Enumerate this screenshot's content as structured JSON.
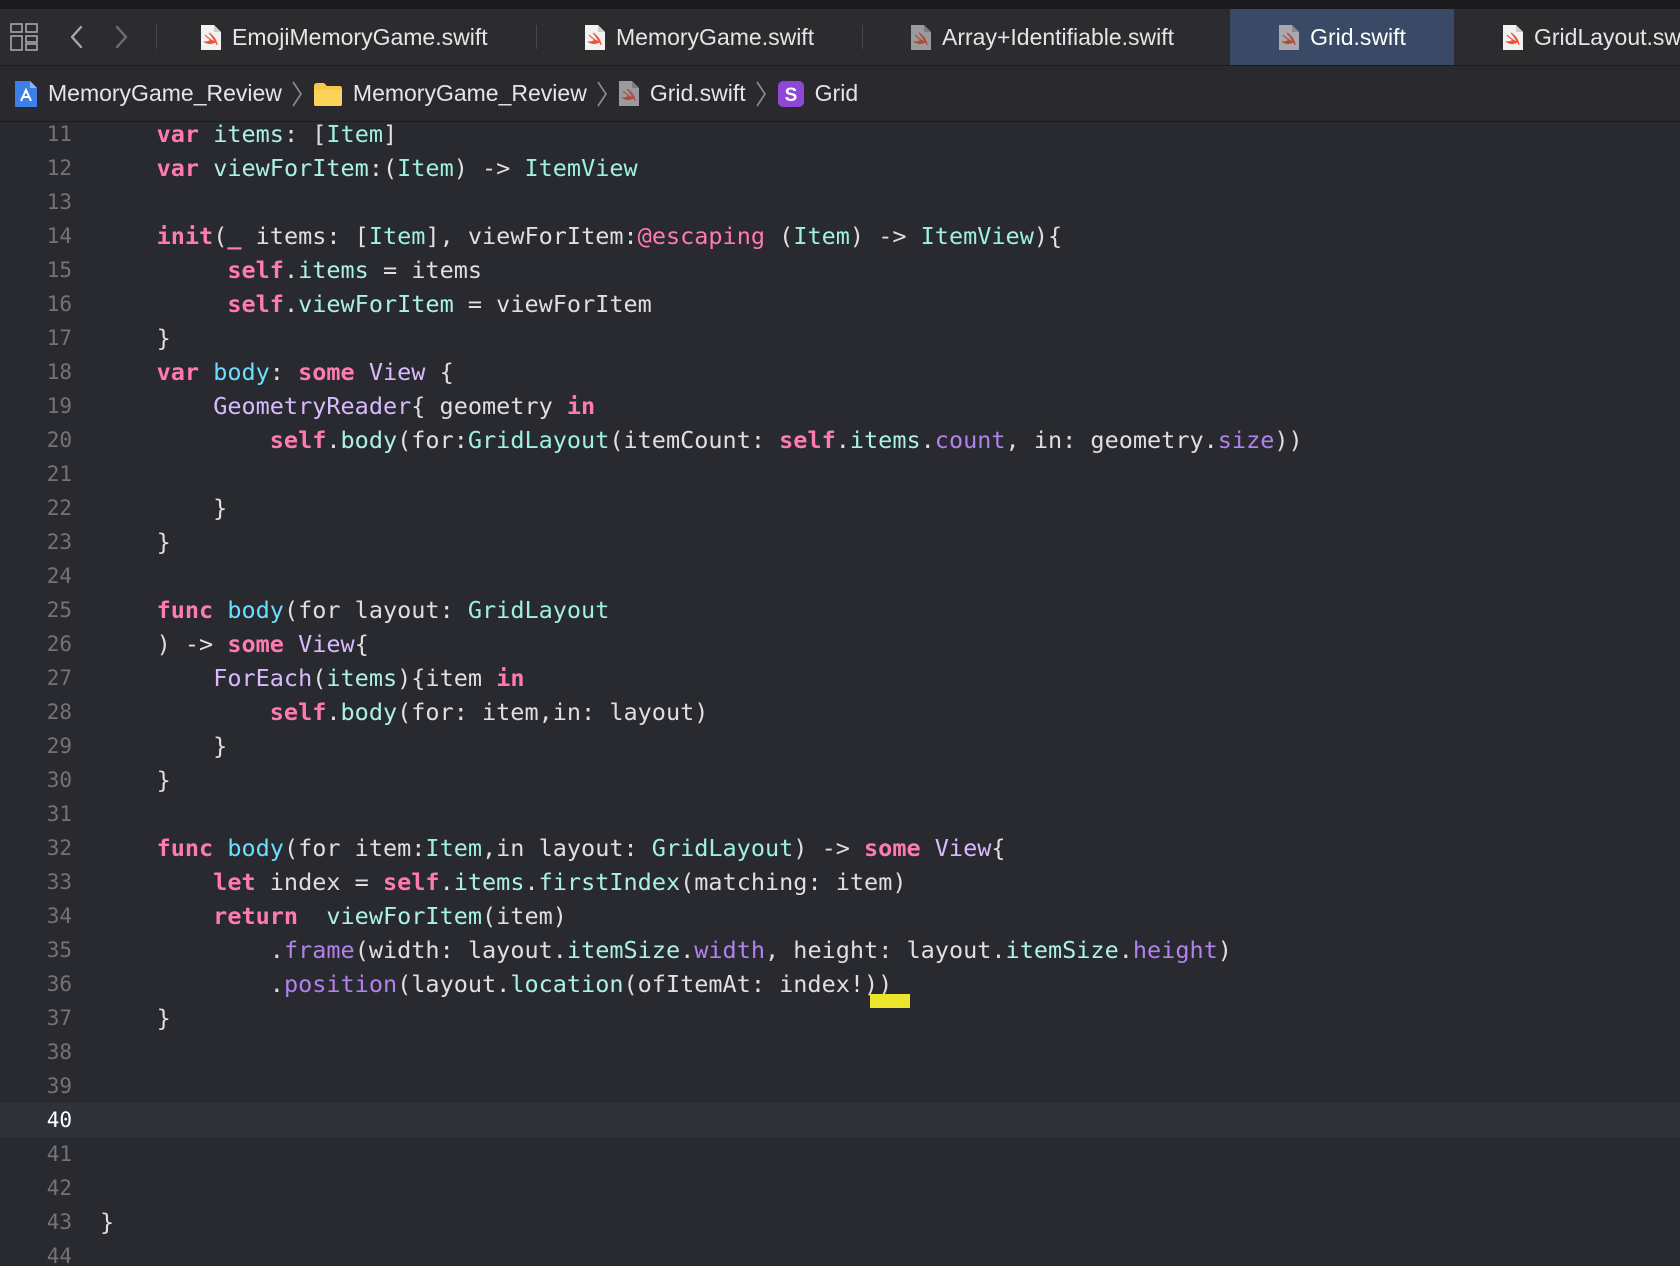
{
  "tabs": [
    {
      "label": "EmojiMemoryGame.swift",
      "active": false
    },
    {
      "label": "MemoryGame.swift",
      "active": false
    },
    {
      "label": "Array+Identifiable.swift",
      "active": false
    },
    {
      "label": "Grid.swift",
      "active": true
    },
    {
      "label": "GridLayout.sw",
      "active": false
    }
  ],
  "breadcrumb": [
    "MemoryGame_Review",
    "MemoryGame_Review",
    "Grid.swift",
    "Grid"
  ],
  "struct_badge_letter": "S",
  "editor": {
    "current_line": 40,
    "lines": [
      {
        "n": "11",
        "t": [
          [
            "    var",
            "kw"
          ],
          [
            " ",
            ""
          ],
          [
            "items",
            "prop"
          ],
          [
            ": [",
            "pl"
          ],
          [
            "Item",
            "tyd"
          ],
          [
            "]",
            "pl"
          ]
        ]
      },
      {
        "n": "12",
        "t": [
          [
            "    var",
            "kw"
          ],
          [
            " ",
            ""
          ],
          [
            "viewForItem",
            "prop"
          ],
          [
            ":(",
            "pl"
          ],
          [
            "Item",
            "tyd"
          ],
          [
            ") -> ",
            "pl"
          ],
          [
            "ItemView",
            "tyd"
          ]
        ]
      },
      {
        "n": "13",
        "t": []
      },
      {
        "n": "14",
        "t": [
          [
            "    init",
            "kw"
          ],
          [
            "(",
            "pl"
          ],
          [
            "_",
            "kw"
          ],
          [
            " items: [",
            "pl"
          ],
          [
            "Item",
            "tyd"
          ],
          [
            "], viewForItem:",
            "pl"
          ],
          [
            "@escaping",
            "attr"
          ],
          [
            " (",
            "pl"
          ],
          [
            "Item",
            "tyd"
          ],
          [
            ") -> ",
            "pl"
          ],
          [
            "ItemView",
            "tyd"
          ],
          [
            "){",
            "pl"
          ]
        ]
      },
      {
        "n": "15",
        "t": [
          [
            "         self",
            "kw"
          ],
          [
            ".",
            "pl"
          ],
          [
            "items",
            "prop"
          ],
          [
            " = items",
            "pl"
          ]
        ]
      },
      {
        "n": "16",
        "t": [
          [
            "         self",
            "kw"
          ],
          [
            ".",
            "pl"
          ],
          [
            "viewForItem",
            "prop"
          ],
          [
            " = viewForItem",
            "pl"
          ]
        ]
      },
      {
        "n": "17",
        "t": [
          [
            "    }",
            "pl"
          ]
        ]
      },
      {
        "n": "18",
        "t": [
          [
            "    var",
            "kw"
          ],
          [
            " ",
            ""
          ],
          [
            "body",
            "fnd"
          ],
          [
            ": ",
            "pl"
          ],
          [
            "some",
            "kw"
          ],
          [
            " ",
            ""
          ],
          [
            "View",
            "ty"
          ],
          [
            " {",
            "pl"
          ]
        ]
      },
      {
        "n": "19",
        "t": [
          [
            "        ",
            ""
          ],
          [
            "GeometryReader",
            "ty"
          ],
          [
            "{ geometry ",
            "pl"
          ],
          [
            "in",
            "kw"
          ]
        ]
      },
      {
        "n": "20",
        "t": [
          [
            "            ",
            ""
          ],
          [
            "self",
            "kw"
          ],
          [
            ".",
            "pl"
          ],
          [
            "body",
            "prop"
          ],
          [
            "(for:",
            "pl"
          ],
          [
            "GridLayout",
            "tyd"
          ],
          [
            "(itemCount: ",
            "pl"
          ],
          [
            "self",
            "kw"
          ],
          [
            ".",
            "pl"
          ],
          [
            "items",
            "prop"
          ],
          [
            ".",
            "pl"
          ],
          [
            "count",
            "sysp"
          ],
          [
            ", in: geometry.",
            "pl"
          ],
          [
            "size",
            "sysp"
          ],
          [
            "))",
            "pl"
          ]
        ]
      },
      {
        "n": "21",
        "t": []
      },
      {
        "n": "22",
        "t": [
          [
            "        }",
            "pl"
          ]
        ]
      },
      {
        "n": "23",
        "t": [
          [
            "    }",
            "pl"
          ]
        ]
      },
      {
        "n": "24",
        "t": []
      },
      {
        "n": "25",
        "t": [
          [
            "    func",
            "kw"
          ],
          [
            " ",
            ""
          ],
          [
            "body",
            "fnd"
          ],
          [
            "(for layout: ",
            "pl"
          ],
          [
            "GridLayout",
            "tyd"
          ]
        ]
      },
      {
        "n": "26",
        "t": [
          [
            "    ) -> ",
            "pl"
          ],
          [
            "some",
            "kw"
          ],
          [
            " ",
            ""
          ],
          [
            "View",
            "ty"
          ],
          [
            "{",
            "pl"
          ]
        ]
      },
      {
        "n": "27",
        "t": [
          [
            "        ",
            ""
          ],
          [
            "ForEach",
            "ty"
          ],
          [
            "(",
            "pl"
          ],
          [
            "items",
            "prop"
          ],
          [
            "){item ",
            "pl"
          ],
          [
            "in",
            "kw"
          ]
        ]
      },
      {
        "n": "28",
        "t": [
          [
            "            ",
            ""
          ],
          [
            "self",
            "kw"
          ],
          [
            ".",
            "pl"
          ],
          [
            "body",
            "prop"
          ],
          [
            "(for: item,in: layout)",
            "pl"
          ]
        ]
      },
      {
        "n": "29",
        "t": [
          [
            "        }",
            "pl"
          ]
        ]
      },
      {
        "n": "30",
        "t": [
          [
            "    }",
            "pl"
          ]
        ]
      },
      {
        "n": "31",
        "t": []
      },
      {
        "n": "32",
        "t": [
          [
            "    func",
            "kw"
          ],
          [
            " ",
            ""
          ],
          [
            "body",
            "fnd"
          ],
          [
            "(for item:",
            "pl"
          ],
          [
            "Item",
            "tyd"
          ],
          [
            ",in layout: ",
            "pl"
          ],
          [
            "GridLayout",
            "tyd"
          ],
          [
            ") -> ",
            "pl"
          ],
          [
            "some",
            "kw"
          ],
          [
            " ",
            ""
          ],
          [
            "View",
            "ty"
          ],
          [
            "{",
            "pl"
          ]
        ]
      },
      {
        "n": "33",
        "t": [
          [
            "        let",
            "kw"
          ],
          [
            " index = ",
            "pl"
          ],
          [
            "self",
            "kw"
          ],
          [
            ".",
            "pl"
          ],
          [
            "items",
            "prop"
          ],
          [
            ".",
            "pl"
          ],
          [
            "firstIndex",
            "prop"
          ],
          [
            "(matching: item)",
            "pl"
          ]
        ]
      },
      {
        "n": "34",
        "t": [
          [
            "        return",
            "kw"
          ],
          [
            "  ",
            ""
          ],
          [
            "viewForItem",
            "prop"
          ],
          [
            "(item)",
            "pl"
          ]
        ]
      },
      {
        "n": "35",
        "t": [
          [
            "            .",
            "pl"
          ],
          [
            "frame",
            "sysp"
          ],
          [
            "(width: layout.",
            "pl"
          ],
          [
            "itemSize",
            "prop"
          ],
          [
            ".",
            "pl"
          ],
          [
            "width",
            "sysp"
          ],
          [
            ", height: layout.",
            "pl"
          ],
          [
            "itemSize",
            "prop"
          ],
          [
            ".",
            "pl"
          ],
          [
            "height",
            "sysp"
          ],
          [
            ")",
            "pl"
          ]
        ]
      },
      {
        "n": "36",
        "t": [
          [
            "            .",
            "pl"
          ],
          [
            "position",
            "sysp"
          ],
          [
            "(layout.",
            "pl"
          ],
          [
            "location",
            "prop"
          ],
          [
            "(ofItemAt: index!))",
            "pl"
          ]
        ]
      },
      {
        "n": "37",
        "t": [
          [
            "    }",
            "pl"
          ]
        ]
      },
      {
        "n": "38",
        "t": []
      },
      {
        "n": "39",
        "t": []
      },
      {
        "n": "40",
        "t": []
      },
      {
        "n": "41",
        "t": []
      },
      {
        "n": "42",
        "t": []
      },
      {
        "n": "43",
        "t": [
          [
            "}",
            "pl"
          ]
        ]
      },
      {
        "n": "44",
        "t": []
      }
    ]
  },
  "colors": {
    "editor_bg": "#292a30",
    "keyword": "#ff7ab2",
    "type_decl": "#9ef1dd",
    "system_type": "#dabaff",
    "property": "#acf2e4",
    "function_decl": "#6bdfff",
    "system_property": "#b281eb",
    "active_tab": "#3a4a66",
    "issue_marker": "#ece52e"
  }
}
